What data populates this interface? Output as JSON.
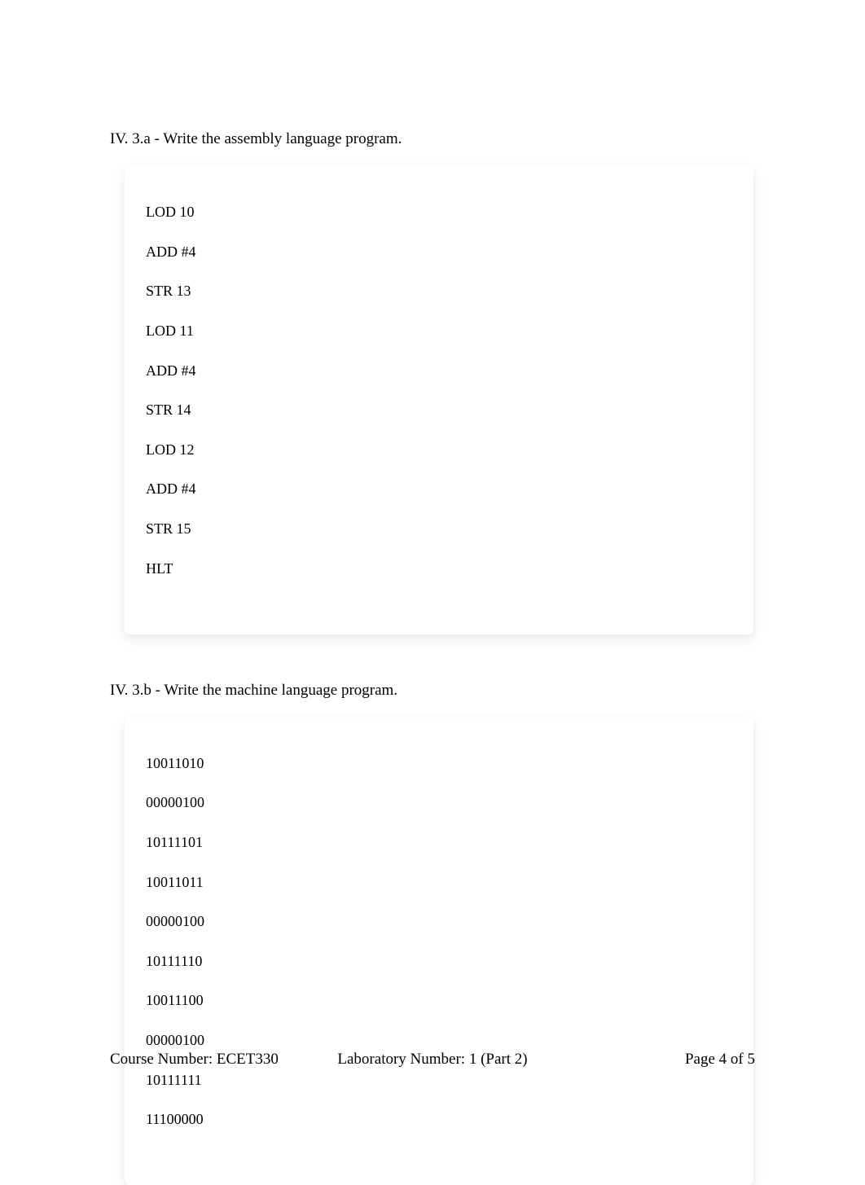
{
  "sections": {
    "a": {
      "heading": "IV. 3.a - Write the assembly language program.",
      "lines": [
        "LOD 10",
        "ADD #4",
        "STR 13",
        "LOD 11",
        "ADD #4",
        "STR 14",
        "LOD 12",
        "ADD #4",
        "STR 15",
        "HLT"
      ]
    },
    "b": {
      "heading": "IV. 3.b - Write the machine language program.",
      "lines": [
        "10011010",
        "00000100",
        "10111101",
        "10011011",
        "00000100",
        "10111110",
        "10011100",
        "00000100",
        "10111111",
        "11100000"
      ]
    }
  },
  "footer": {
    "left": "Course Number: ECET330",
    "center": "Laboratory Number: 1 (Part 2)",
    "right": "Page 4 of 5"
  }
}
